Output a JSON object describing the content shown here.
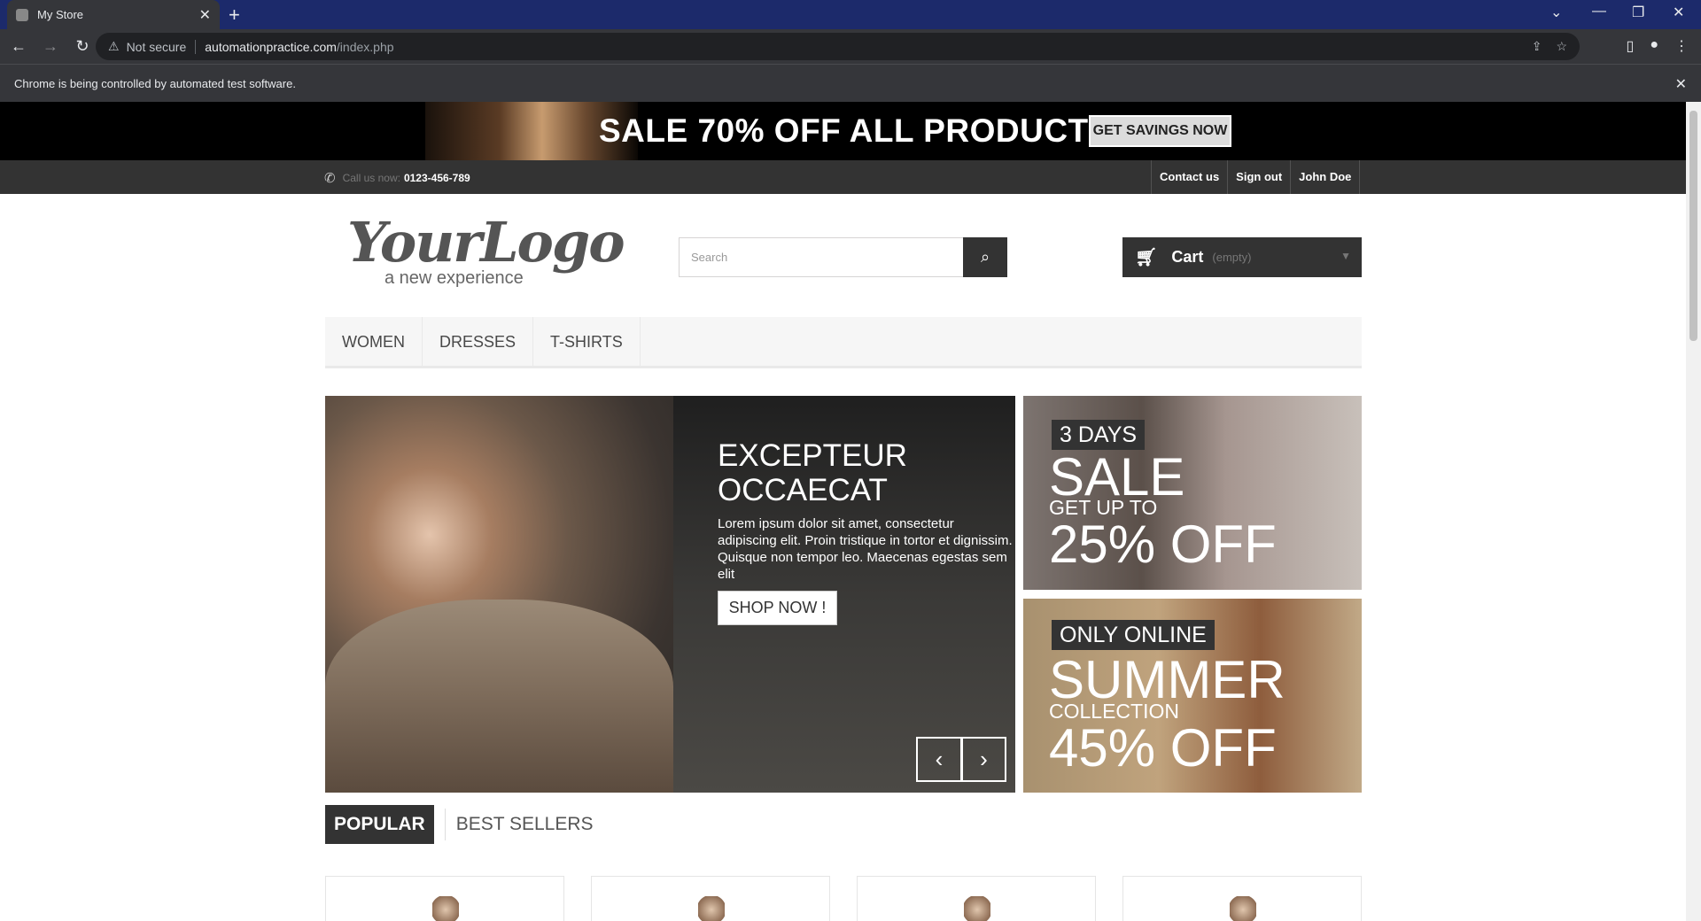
{
  "browser": {
    "tab_title": "My Store",
    "new_tab": "+",
    "url_warning": "Not secure",
    "url_host": "automationpractice.com",
    "url_path": "/index.php",
    "infobar_text": "Chrome is being controlled by automated test software."
  },
  "banner": {
    "headline": "SALE 70% OFF ALL PRODUCTS",
    "button": "GET SAVINGS NOW"
  },
  "topbar": {
    "call_label": "Call us now:",
    "phone": "0123-456-789",
    "links": [
      "Contact us",
      "Sign out",
      "John Doe"
    ]
  },
  "logo": {
    "script": "YourLogo",
    "tagline": "a new experience"
  },
  "search": {
    "placeholder": "Search"
  },
  "cart": {
    "label": "Cart",
    "status": "(empty)"
  },
  "menu": {
    "items": [
      "Women",
      "Dresses",
      "T-shirts"
    ]
  },
  "slider": {
    "title_line1": "Excepteur",
    "title_line2": "Occaecat",
    "text": "Lorem ipsum dolor sit amet, consectetur adipiscing elit. Proin tristique in tortor et dignissim. Quisque non tempor leo. Maecenas egestas sem elit",
    "button": "SHOP NOW !"
  },
  "promos": [
    {
      "badge": "3 DAYS",
      "big1": "SALE",
      "small": "GET UP TO",
      "big2": "25% OFF"
    },
    {
      "badge": "ONLY ONLINE",
      "big1": "SUMMER",
      "small": "COLLECTION",
      "big2": "45% OFF"
    }
  ],
  "product_tabs": {
    "active": "POPULAR",
    "other": "BEST SELLERS"
  },
  "icons": {
    "phone": "phone-icon",
    "search": "search-icon",
    "cart": "cart-icon"
  },
  "colors": {
    "chrome_tabbar": "#1c2a6b",
    "chrome_toolbar": "#35363a",
    "dark": "#333333",
    "banner": "#000000"
  }
}
